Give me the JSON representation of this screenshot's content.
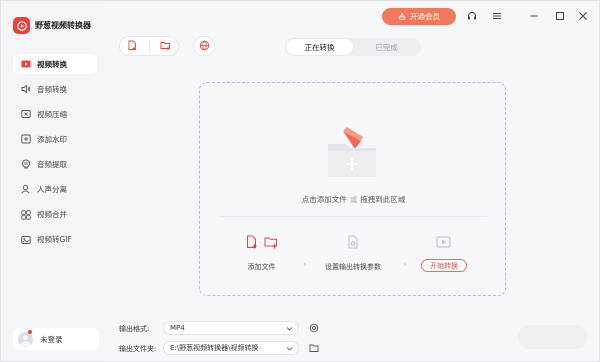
{
  "app": {
    "title": "野葱视频转换器"
  },
  "header": {
    "vip_label": "开通会员"
  },
  "sidebar": {
    "items": [
      {
        "label": "视频转换",
        "icon": "video-convert-icon",
        "active": true
      },
      {
        "label": "音频转换",
        "icon": "audio-convert-icon",
        "active": false
      },
      {
        "label": "视频压缩",
        "icon": "video-compress-icon",
        "active": false
      },
      {
        "label": "添加水印",
        "icon": "watermark-icon",
        "active": false
      },
      {
        "label": "音频提取",
        "icon": "audio-extract-icon",
        "active": false
      },
      {
        "label": "人声分离",
        "icon": "voice-separate-icon",
        "active": false
      },
      {
        "label": "视频合并",
        "icon": "video-merge-icon",
        "active": false
      },
      {
        "label": "视频转GIF",
        "icon": "gif-icon",
        "active": false
      }
    ],
    "login_label": "未登录"
  },
  "tabs": [
    {
      "label": "正在转换",
      "active": true
    },
    {
      "label": "已完成",
      "active": false
    }
  ],
  "dropzone": {
    "text_add": "点击添加文件",
    "text_or": "或",
    "text_drag": "拖拽到此区域",
    "steps": [
      {
        "label": "添加文件"
      },
      {
        "label": "设置输出转换参数"
      },
      {
        "label": "开始转换"
      }
    ]
  },
  "output": {
    "format_label": "输出格式:",
    "format_value": "MP4",
    "folder_label": "输出文件夹:",
    "folder_value": "E:\\野葱视频转换器\\视频转换"
  },
  "colors": {
    "accent": "#f0423a",
    "vip": "#f4795a",
    "dropzone_border": "#b7b4ee"
  }
}
